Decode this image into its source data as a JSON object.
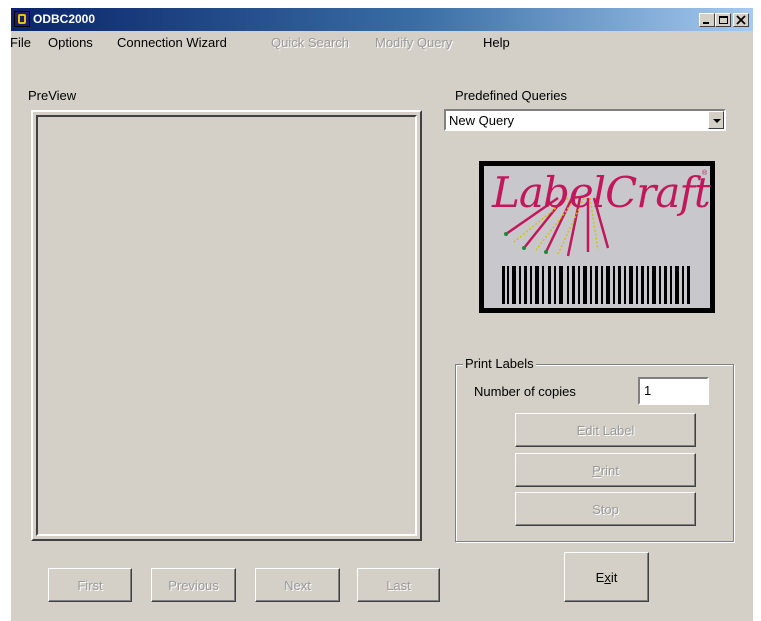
{
  "window": {
    "title": "ODBC2000"
  },
  "titlebar_controls": [
    "minimize-icon",
    "maximize-icon",
    "close-icon"
  ],
  "menu": {
    "items": [
      {
        "label": "File",
        "enabled": true
      },
      {
        "label": "Options",
        "enabled": true
      },
      {
        "label": "Connection Wizard",
        "enabled": true
      },
      {
        "label": "Quick Search",
        "enabled": false
      },
      {
        "label": "Modify Query",
        "enabled": false
      },
      {
        "label": "Help",
        "enabled": true
      }
    ]
  },
  "preview": {
    "label": "PreView",
    "nav": {
      "first": "First",
      "previous": "Previous",
      "next": "Next",
      "last": "Last"
    }
  },
  "queries": {
    "label": "Predefined Queries",
    "selected": "New Query"
  },
  "logo": {
    "text": "LabelCraft",
    "mark": "®"
  },
  "print_labels": {
    "title": "Print Labels",
    "copies_label": "Number of copies",
    "copies_value": "1",
    "edit_label": "Edit Label",
    "print_pre": "",
    "print_mnemonic": "P",
    "print_post": "rint",
    "stop": "Stop"
  },
  "exit": {
    "pre": "E",
    "mnemonic": "x",
    "post": "it"
  },
  "colors": {
    "title_start": "#0a246a",
    "title_end": "#a6caf0",
    "face": "#d4d0c8",
    "logo_text": "#c2185b"
  }
}
